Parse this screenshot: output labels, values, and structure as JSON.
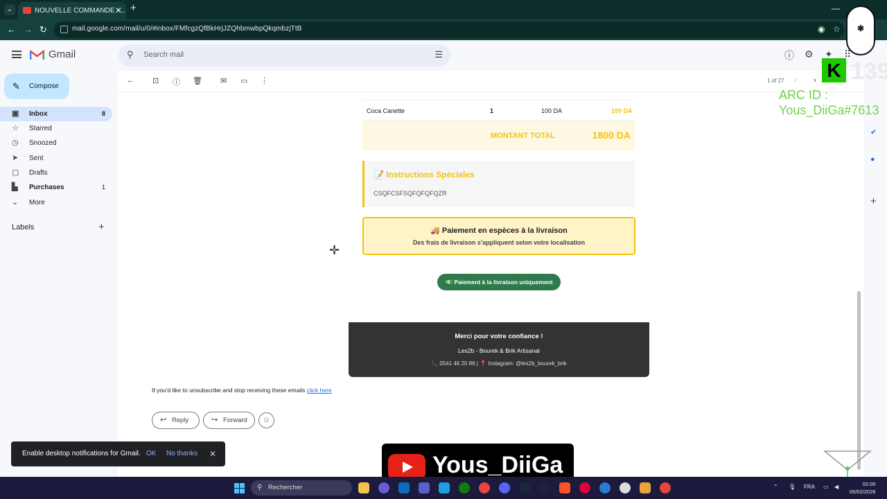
{
  "browser": {
    "tab_title": "NOUVELLE COMMANDE -...",
    "url": "mail.google.com/mail/u/0/#inbox/FMfcgzQfBkHrjJZQhbmwbpQkqmbzjTtB"
  },
  "gmail": {
    "brand": "Gmail",
    "search_placeholder": "Search mail",
    "compose": "Compose",
    "nav": [
      {
        "label": "Inbox",
        "count": "8"
      },
      {
        "label": "Starred",
        "count": ""
      },
      {
        "label": "Snoozed",
        "count": ""
      },
      {
        "label": "Sent",
        "count": ""
      },
      {
        "label": "Drafts",
        "count": ""
      },
      {
        "label": "Purchases",
        "count": "1"
      },
      {
        "label": "More",
        "count": ""
      }
    ],
    "labels_heading": "Labels",
    "pager": "1 of 27"
  },
  "email": {
    "item_name": "Coca Canette",
    "item_qty": "1",
    "item_price": "100 DA",
    "item_total": "100 DA",
    "total_label": "MONTANT TOTAL",
    "total_value": "1800 DA",
    "instructions_title": "📝 Instructions Spéciales",
    "instructions_text": "CSQFCSFSQFQFQFQZR",
    "payment_title": "🚚 Paiement en espèces à la livraison",
    "payment_sub": "Des frais de livraison s'appliquent selon votre localisation",
    "cod_badge": "💵 Paiement à la livraison uniquement",
    "footer_thanks": "Merci pour votre confiance !",
    "footer_brand": "Les2b - Bourek & Brik Artisanal",
    "footer_contact": "📞 0541 46 20 86 | 📍 Instagram: @les2b_bourek_brik",
    "unsubscribe_text": "If you'd like to unsubscribe and stop receiving these emails",
    "unsubscribe_link": "click here",
    "reply": "Reply",
    "forward": "Forward"
  },
  "toast": {
    "text": "Enable desktop notifications for Gmail.",
    "ok": "OK",
    "no_thanks": "No thanks"
  },
  "overlay": {
    "k_count": "139",
    "arc_line1": "ARC ID :",
    "arc_line2": "Yous_DiiGa#7613",
    "youtube_name": "Yous_DiiGa"
  },
  "taskbar": {
    "search": "Rechercher",
    "lang": "FRA",
    "time": "02:00",
    "date": "05/02/2026"
  },
  "colors": {
    "accent_yellow": "#f4c20d",
    "cod_green": "#2f7a4d",
    "footer_dark": "#333333",
    "inbox_active": "#d3e3fd"
  }
}
